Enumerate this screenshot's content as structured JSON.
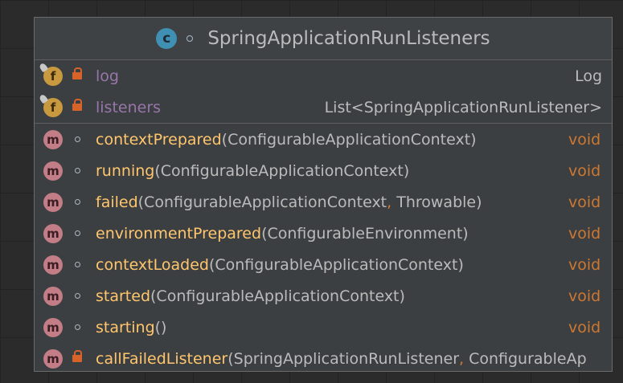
{
  "class_name": "SpringApplicationRunListeners",
  "class_icon": "c-class-icon",
  "fields": [
    {
      "name": "log",
      "type": "Log"
    },
    {
      "name": "listeners",
      "type": "List<SpringApplicationRunListener>"
    }
  ],
  "methods": [
    {
      "name": "contextPrepared",
      "params": "(ConfigurableApplicationContext)",
      "ret": "void"
    },
    {
      "name": "running",
      "params": "(ConfigurableApplicationContext)",
      "ret": "void"
    },
    {
      "name": "failed",
      "p1": "(ConfigurableApplicationContext",
      "sep": ",",
      "p2": " Throwable)",
      "ret": "void"
    },
    {
      "name": "environmentPrepared",
      "params": "(ConfigurableEnvironment)",
      "ret": "void"
    },
    {
      "name": "contextLoaded",
      "params": "(ConfigurableApplicationContext)",
      "ret": "void"
    },
    {
      "name": "started",
      "params": "(ConfigurableApplicationContext)",
      "ret": "void"
    },
    {
      "name": "starting",
      "params": "()",
      "ret": "void"
    },
    {
      "name": "callFailedListener",
      "p1": "(SpringApplicationRunListener",
      "sep": ",",
      "p2": " ConfigurableAp"
    }
  ],
  "badges": {
    "field": "f",
    "method": "m",
    "class": "c"
  },
  "colors": {
    "background": "#2b2b2b",
    "node": "#3c3f41",
    "field_name": "#9876aa",
    "method_name": "#ffc66d",
    "keyword": "#cc7832",
    "class_icon": "#3f90b3"
  }
}
